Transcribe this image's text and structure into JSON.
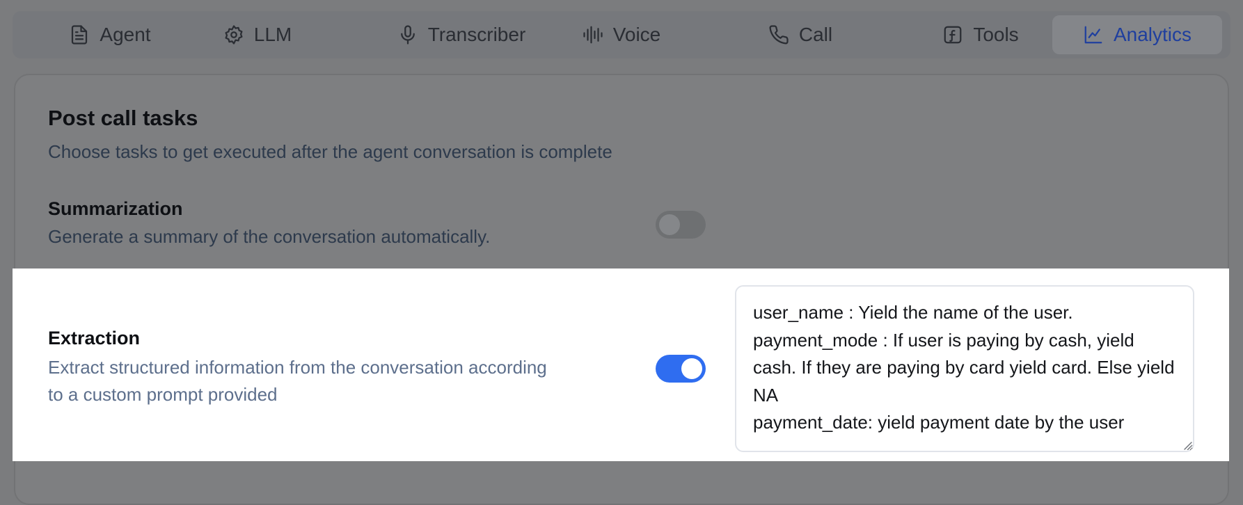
{
  "tabs": [
    {
      "label": "Agent",
      "icon": "document-icon",
      "active": false
    },
    {
      "label": "LLM",
      "icon": "gear-icon",
      "active": false
    },
    {
      "label": "Transcriber",
      "icon": "microphone-icon",
      "active": false
    },
    {
      "label": "Voice",
      "icon": "waveform-icon",
      "active": false
    },
    {
      "label": "Call",
      "icon": "phone-icon",
      "active": false
    },
    {
      "label": "Tools",
      "icon": "function-icon",
      "active": false
    },
    {
      "label": "Analytics",
      "icon": "chart-line-icon",
      "active": true
    }
  ],
  "section": {
    "title": "Post call tasks",
    "subtitle": "Choose tasks to get executed after the agent conversation is complete"
  },
  "summarization": {
    "title": "Summarization",
    "description": "Generate a summary of the conversation automatically.",
    "enabled": false
  },
  "extraction": {
    "title": "Extraction",
    "description_line1": "Extract structured information from the conversation according",
    "description_line2": "to a custom prompt provided",
    "enabled": true,
    "prompt_text": "user_name : Yield the name of the user.\npayment_mode : If user is paying by cash, yield cash. If they are paying by card yield card. Else yield NA\npayment_date: yield payment date by the user"
  },
  "colors": {
    "accent": "#2f6df0",
    "active_tab_text": "#1f3f9e",
    "overlay": "#7b7c7e"
  }
}
